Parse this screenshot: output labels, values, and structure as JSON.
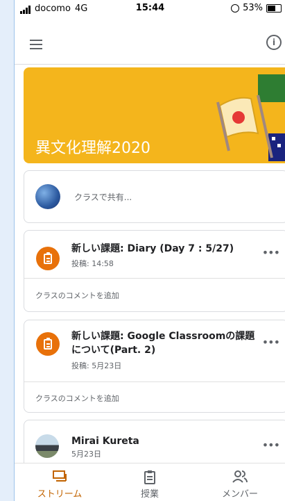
{
  "status": {
    "carrier": "docomo",
    "network": "4G",
    "time": "15:44",
    "battery": "53%"
  },
  "banner": {
    "title": "異文化理解2020",
    "color": "#f4b51c"
  },
  "share": {
    "placeholder": "クラスで共有..."
  },
  "posts": [
    {
      "title": "新しい課題: Diary (Day 7 : 5/27)",
      "meta": "投稿: 14:58",
      "comment": "クラスのコメントを追加"
    },
    {
      "title": "新しい課題: Google Classroomの課題について(Part. 2)",
      "meta": "投稿: 5月23日",
      "comment": "クラスのコメントを追加"
    },
    {
      "author": "Mirai Kureta",
      "meta": "5月23日"
    }
  ],
  "nav": [
    {
      "label": "ストリーム",
      "active": true,
      "icon": "stream-icon"
    },
    {
      "label": "授業",
      "active": false,
      "icon": "classwork-icon"
    },
    {
      "label": "メンバー",
      "active": false,
      "icon": "people-icon"
    }
  ],
  "colors": {
    "accent": "#e8710a",
    "active_nav": "#c26401",
    "text": "#202124",
    "muted": "#5f6368"
  }
}
